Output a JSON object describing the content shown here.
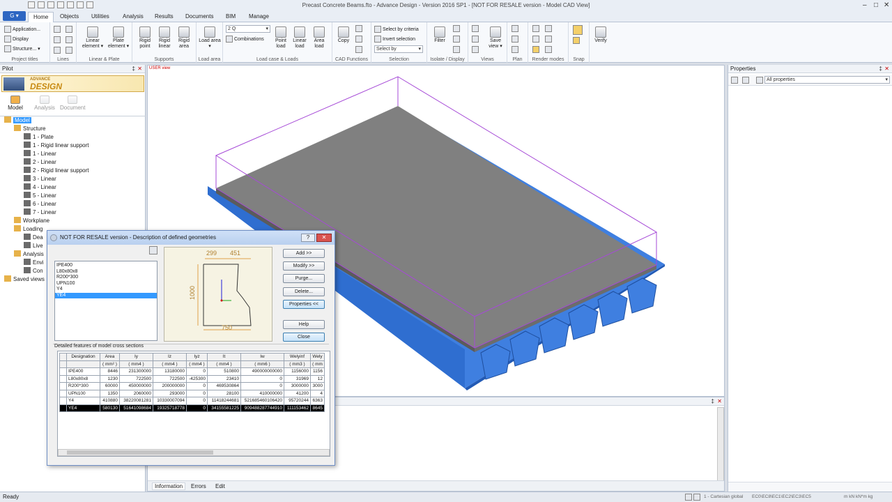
{
  "window": {
    "title": "Precast Concrete Beams.fto - Advance Design - Version 2016 SP1 - [NOT FOR RESALE version - Model CAD View]",
    "app_button": "G"
  },
  "tabs": [
    "Home",
    "Objects",
    "Utilities",
    "Analysis",
    "Results",
    "Documents",
    "BIM",
    "Manage"
  ],
  "ribbon": {
    "project_titles": {
      "items": [
        "Application...",
        "Display",
        "Structure..."
      ],
      "label": "Project titles"
    },
    "lines": {
      "label": "Lines"
    },
    "linear_plate": {
      "linear_element": "Linear element",
      "plate_element": "Plate element",
      "label": "Linear & Plate"
    },
    "supports": {
      "rigid_point": "Rigid point",
      "rigid_linear": "Rigid linear",
      "rigid_area": "Rigid area",
      "label": "Supports"
    },
    "load_area": {
      "load_area": "Load area",
      "label": "Load area"
    },
    "load_case": {
      "case_value": "2 Q",
      "combinations": "Combinations",
      "point_load": "Point load",
      "linear_load": "Linear load",
      "area_load": "Area load",
      "label": "Load case & Loads"
    },
    "cad": {
      "copy": "Copy",
      "label": "CAD Functions"
    },
    "selection": {
      "select_by_criteria": "Select by criteria",
      "invert_selection": "Invert selection",
      "select_by": "Select by",
      "label": "Selection"
    },
    "isolate": {
      "filter": "Filter",
      "label": "Isolate / Display"
    },
    "views": {
      "save_view": "Save view",
      "label": "Views"
    },
    "plan": {
      "label": "Plan"
    },
    "render": {
      "label": "Render modes"
    },
    "snap": {
      "label": "Snap"
    },
    "verify": {
      "verify": "Verify"
    }
  },
  "pilot": {
    "title": "Pilot",
    "logo_small": "ADVANCE",
    "logo_big": "DESIGN",
    "modes": [
      "Model",
      "Analysis",
      "Document"
    ],
    "tree": [
      {
        "label": "Model",
        "level": 0,
        "selected": true
      },
      {
        "label": "Structure",
        "level": 1
      },
      {
        "label": "1 - Plate",
        "level": 2
      },
      {
        "label": "1 - Rigid linear support",
        "level": 2
      },
      {
        "label": "1 - Linear",
        "level": 2
      },
      {
        "label": "2 - Linear",
        "level": 2
      },
      {
        "label": "2 - Rigid linear support",
        "level": 2
      },
      {
        "label": "3 - Linear",
        "level": 2
      },
      {
        "label": "4 - Linear",
        "level": 2
      },
      {
        "label": "5 - Linear",
        "level": 2
      },
      {
        "label": "6 - Linear",
        "level": 2
      },
      {
        "label": "7 - Linear",
        "level": 2
      },
      {
        "label": "Workplane",
        "level": 1
      },
      {
        "label": "Loading",
        "level": 1
      },
      {
        "label": "Dea",
        "level": 2
      },
      {
        "label": "Live",
        "level": 2
      },
      {
        "label": "Analysis",
        "level": 1
      },
      {
        "label": "Envi",
        "level": 2
      },
      {
        "label": "Con",
        "level": 2
      },
      {
        "label": "Saved views",
        "level": 0
      }
    ]
  },
  "viewport": {
    "view_label": "USER view"
  },
  "bottom_panel": {
    "tabs": [
      "Information",
      "Errors",
      "Edit"
    ]
  },
  "properties": {
    "title": "Properties",
    "filter": "All properties"
  },
  "status": {
    "left": "Ready",
    "coord_system": "1 - Cartesian global",
    "codes": "EC0\\EC8\\EC1\\EC2\\EC3\\EC5",
    "units": "m  kN  kN*m  kg"
  },
  "dialog": {
    "title": "NOT FOR RESALE version - Description of defined geometries",
    "geometries": [
      "IPE400",
      "L80x80x8",
      "R200*300",
      "UPN100",
      "Y4",
      "YE4"
    ],
    "selected_index": 5,
    "preview": {
      "top_left": "299",
      "top_right": "451",
      "height": "1000",
      "bottom": "750"
    },
    "buttons": [
      "Add >>",
      "Modify >>",
      "Purge...",
      "Delete...",
      "Properties <<",
      "Help",
      "Close"
    ],
    "section_label": "Detailed features of model cross sections",
    "table": {
      "headers": [
        "Designation",
        "Area",
        "Iy",
        "Iz",
        "Iyz",
        "It",
        "Iw",
        "Welyinf",
        "Wely"
      ],
      "units": [
        "",
        "( mm² )",
        "( mm4 )",
        "( mm4 )",
        "( mm4 )",
        "( mm4 )",
        "( mm6 )",
        "( mm3 )",
        "( mm"
      ],
      "rows": [
        [
          "IPE400",
          "8446",
          "231300000",
          "13180000",
          "0",
          "510800",
          "490000000000",
          "1156000",
          "1156"
        ],
        [
          "L80x80x8",
          "1230",
          "722500",
          "722500",
          "-425300",
          "23410",
          "0",
          "31969",
          "12"
        ],
        [
          "R200*300",
          "60000",
          "450000000",
          "200000000",
          "0",
          "469530864",
          "0",
          "3000000",
          "3000"
        ],
        [
          "UPN100",
          "1350",
          "2060000",
          "293000",
          "0",
          "28100",
          "410000000",
          "41200",
          "4"
        ],
        [
          "Y4",
          "410880",
          "38220081281",
          "10330007094",
          "0",
          "11418244681",
          "521685460106420",
          "95720244",
          "6363"
        ],
        [
          "YE4",
          "580130",
          "51641098684",
          "19325718778",
          "0",
          "34155581225",
          "909488287744910",
          "111153462",
          "8645"
        ]
      ]
    }
  },
  "colors": {
    "accent": "#2d66c2",
    "beam_blue": "#3f7fe0",
    "slab_gray": "#7f7f7f",
    "bbox": "#a64ad7"
  }
}
